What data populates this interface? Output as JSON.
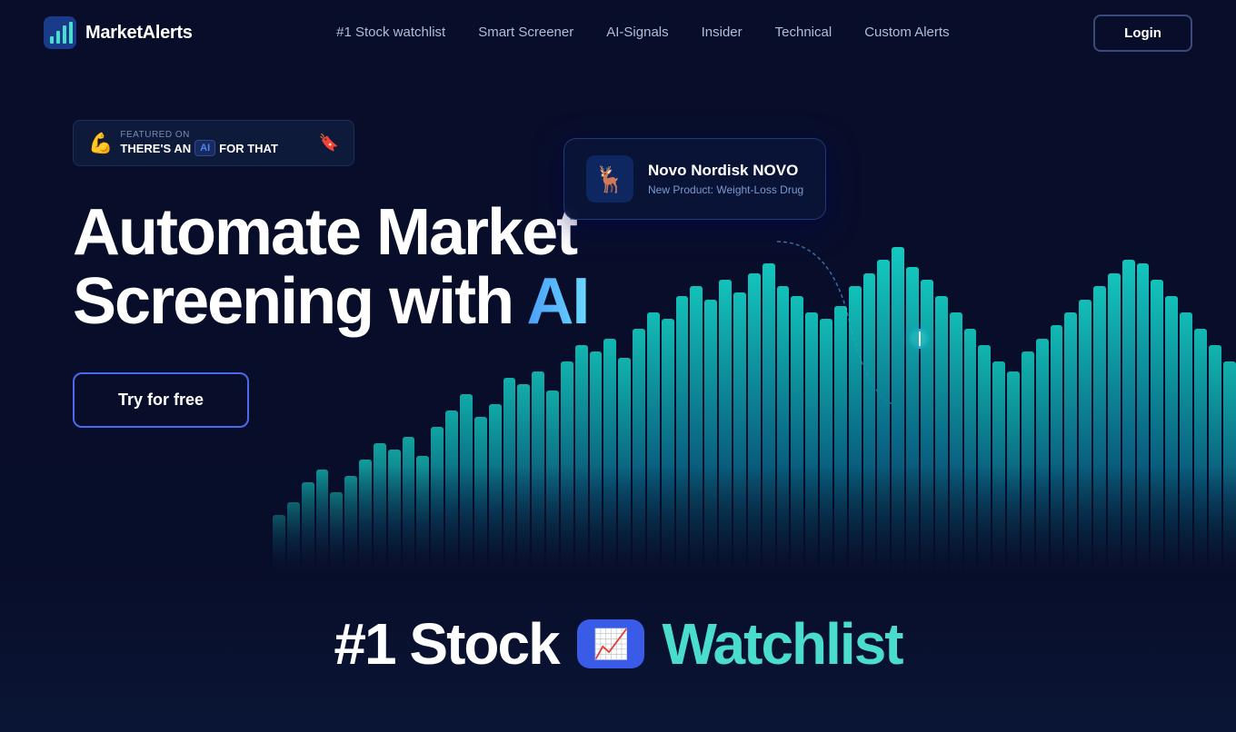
{
  "nav": {
    "logo_text": "MarketAlerts",
    "links": [
      {
        "label": "#1 Stock watchlist",
        "id": "nav-watchlist"
      },
      {
        "label": "Smart Screener",
        "id": "nav-screener"
      },
      {
        "label": "AI-Signals",
        "id": "nav-signals"
      },
      {
        "label": "Insider",
        "id": "nav-insider"
      },
      {
        "label": "Technical",
        "id": "nav-technical"
      },
      {
        "label": "Custom Alerts",
        "id": "nav-alerts"
      }
    ],
    "login_label": "Login"
  },
  "hero": {
    "badge": {
      "featured_label": "FEATURED ON",
      "main_text": "THERE'S AN",
      "ai_label": "AI",
      "suffix": "FOR THAT"
    },
    "headline_line1": "Automate Market",
    "headline_line2_prefix": "Screening with ",
    "headline_ai": "AI",
    "cta_label": "Try for free"
  },
  "stock_card": {
    "name": "Novo Nordisk NOVO",
    "tag": "New Product: Weight-Loss Drug",
    "icon": "🦌"
  },
  "bottom": {
    "title_1": "#1 Stock",
    "title_2": "Watchlist",
    "badge_icon": "📈"
  },
  "chart": {
    "bars": [
      18,
      22,
      28,
      32,
      25,
      30,
      35,
      40,
      38,
      42,
      36,
      45,
      50,
      55,
      48,
      52,
      60,
      58,
      62,
      56,
      65,
      70,
      68,
      72,
      66,
      75,
      80,
      78,
      85,
      88,
      84,
      90,
      86,
      92,
      95,
      88,
      85,
      80,
      78,
      82,
      88,
      92,
      96,
      100,
      94,
      90,
      85,
      80,
      75,
      70,
      65,
      62,
      68,
      72,
      76,
      80,
      84,
      88,
      92,
      96,
      95,
      90,
      85,
      80,
      75,
      70,
      65
    ]
  }
}
